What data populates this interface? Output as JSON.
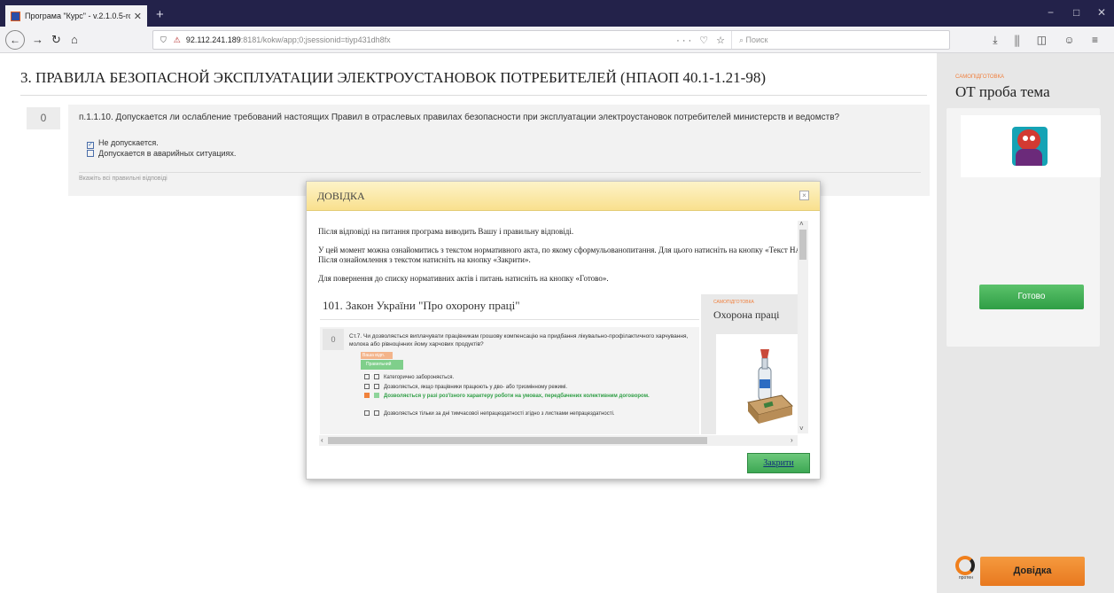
{
  "browser": {
    "tab_title": "Програма \"Курс\" - v.2.1.0.5-rc",
    "new_tab": "+",
    "url_host": "92.112.241.189",
    "url_path": ":8181/kokw/app;0;jsessionid=tiyp431dh8fx",
    "search_placeholder": "Поиск",
    "page_actions": "··· ♡ ☆",
    "window_controls": [
      "−",
      "□",
      "✕"
    ],
    "toolbar_icons": "⤓ ⫼ ◫ ☺ ≡"
  },
  "page": {
    "title": "3. ПРАВИЛА БЕЗОПАСНОЙ ЭКСПЛУАТАЦИИ ЭЛЕКТРОУСТАНОВОК ПОТРЕБИТЕЛЕЙ (НПАОП 40.1-1.21-98)",
    "question_number": "0",
    "question_text": "п.1.1.10. Допускается ли ослабление требований настоящих Правил в отраслевых правилах безопасности при эксплуатации электроустановок потребителей министерств и ведомств?",
    "answers": [
      {
        "label": "Не допускается.",
        "checked": true
      },
      {
        "label": "Допускается в аварийных ситуациях.",
        "checked": false
      }
    ],
    "hint": "Вкажіть всі правильні відповіді"
  },
  "sidebar": {
    "label": "САМОПІДГОТОВКА",
    "title": "ОТ проба тема",
    "ready_button": "Готово",
    "help_button": "Довідка",
    "logo_text": "протен"
  },
  "modal": {
    "title": "ДОВІДКА",
    "close_glyph": "×",
    "paragraphs": [
      "Після відповіді на питання програма виводить Вашу і правильну відповіді.",
      "У цей момент можна ознайомитись з текстом нормативного акта, по якому сформульованопитання. Для цього натисніть на кнопку «Текст НА». Після ознайомлення з текстом натисніть на кнопку «Закрити».",
      "Для повернення до списку нормативних актів і питань натисніть на кнопку «Готово»."
    ],
    "close_button": "Закрити",
    "example": {
      "title": "101. Закон України \"Про охорону праці\"",
      "side_label": "САМОПІДГОТОВКА",
      "side_title": "Охорона праці",
      "question_number": "0",
      "question_text": "Ст.7. Чи дозволяється виплачувати працівникам грошову компенсацію на придбання лікувально-профілактичного харчування, молока або рівноцінних йому харчових продуктів?",
      "badge_your": "Ваша відп.",
      "badge_correct": "Правильний ответ",
      "answers": [
        {
          "label": "Категорично забороняється.",
          "correct": false
        },
        {
          "label": "Дозволяється, якщо працівники працюють у дво- або тризмінному режимі.",
          "correct": false
        },
        {
          "label": "Дозволяється у разі роз'їзного характеру роботи на умовах, передбачених колективним договором.",
          "correct": true
        },
        {
          "label": "Дозволяється тільки за дні тимчасової непрацездатності згідно з листками непрацездатності.",
          "correct": false
        }
      ]
    }
  }
}
